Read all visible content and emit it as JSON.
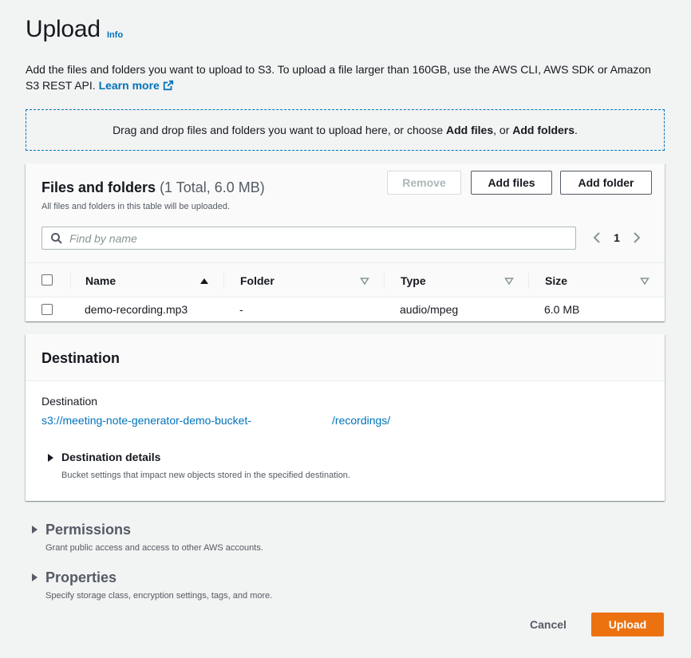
{
  "header": {
    "title": "Upload",
    "info": "Info",
    "description": "Add the files and folders you want to upload to S3. To upload a file larger than 160GB, use the AWS CLI, AWS SDK or Amazon S3 REST API.",
    "learn_more": "Learn more"
  },
  "dropzone": {
    "text_before": "Drag and drop files and folders you want to upload here, or choose ",
    "add_files": "Add files",
    "text_middle": ", or ",
    "add_folders": "Add folders",
    "text_after": "."
  },
  "files": {
    "title": "Files and folders",
    "count": "(1 Total, 6.0 MB)",
    "subtitle": "All files and folders in this table will be uploaded.",
    "remove_label": "Remove",
    "add_files_label": "Add files",
    "add_folder_label": "Add folder",
    "search_placeholder": "Find by name",
    "page": "1",
    "columns": [
      "Name",
      "Folder",
      "Type",
      "Size"
    ],
    "rows": [
      {
        "name": "demo-recording.mp3",
        "folder": "-",
        "type": "audio/mpeg",
        "size": "6.0 MB"
      }
    ]
  },
  "destination": {
    "title": "Destination",
    "label": "Destination",
    "path_prefix": "s3://meeting-note-generator-demo-bucket-",
    "path_suffix": "/recordings/",
    "details_title": "Destination details",
    "details_sub": "Bucket settings that impact new objects stored in the specified destination."
  },
  "permissions": {
    "title": "Permissions",
    "subtitle": "Grant public access and access to other AWS accounts."
  },
  "properties": {
    "title": "Properties",
    "subtitle": "Specify storage class, encryption settings, tags, and more."
  },
  "footer": {
    "cancel_label": "Cancel",
    "upload_label": "Upload"
  },
  "colors": {
    "link": "#0073bb",
    "primary": "#ec7211",
    "background": "#f2f3f3"
  }
}
